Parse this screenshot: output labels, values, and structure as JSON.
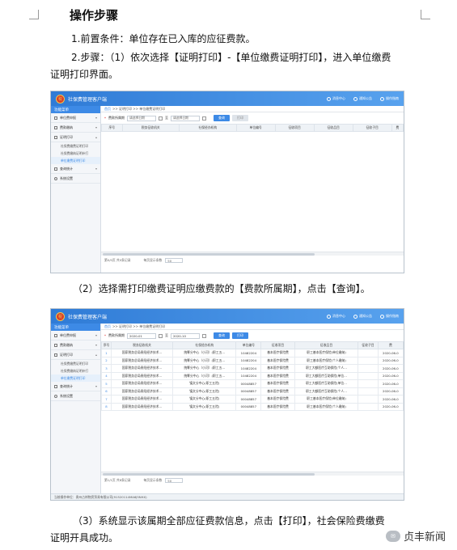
{
  "document": {
    "title": "操作步骤",
    "step1": "1.前置条件：单位存在已入库的应征费款。",
    "step2_line1": "2.步骤：（1）依次选择【证明打印】-【单位缴费证明打印】，进入单位缴费",
    "step2_line2": "证明打印界面。",
    "step2b": "（2）选择需打印缴费证明应缴费款的【费款所属期】，点击【查询】。",
    "step3_line1": "（3）系统显示该属期全部应征费款信息，点击【打印】，社会保险费缴费",
    "step3_line2": "证明开具成功。"
  },
  "app": {
    "title": "社保费管理客户端",
    "emblem": "税",
    "top_links": [
      "消息中心",
      "通知公告",
      "操作指南"
    ],
    "home": "功能菜单",
    "menu": [
      {
        "label": "单位费申报"
      },
      {
        "label": "费款缴纳"
      },
      {
        "label": "证明打印"
      }
    ],
    "submenu": [
      "社保费缴费证明打印",
      "社保费缴纳证明补打",
      "单位缴费证明打印"
    ],
    "menu_after": [
      {
        "label": "查询统计"
      },
      {
        "label": "系统设置"
      }
    ],
    "breadcrumb_home": "首页",
    "breadcrumb_path": ">> 证明打印 >> 单位缴费证明打印",
    "breadcrumb_tab": "单位缴费证明打印",
    "period_label": "费款所属期",
    "to_label": "至",
    "start_placeholder": "请选择日期",
    "end_placeholder": "请选择日期",
    "start_value": "2020-01",
    "end_value": "2020-10",
    "query_button": "查询",
    "print_button": "打印",
    "columns": [
      "序号",
      "税务征收机关",
      "社保经办机构",
      "单位编号",
      "征收项目",
      "征收品目",
      "征收子目",
      "费"
    ],
    "rows": [
      [
        "1",
        "国家税务总局贵阳经济技术…",
        "统筹分中心（小河）(职工五…",
        "10482204",
        "基本医疗保险费",
        "职工基本医疗保险(单位缴纳)",
        "",
        "2020-06-0"
      ],
      [
        "2",
        "国家税务总局贵阳经济技术…",
        "统筹分中心（小河）(职工五…",
        "10482204",
        "基本医疗保险费",
        "职工基本医疗保险(个人缴纳)",
        "",
        "2020-06-0"
      ],
      [
        "3",
        "国家税务总局贵阳经济技术…",
        "统筹分中心（小河）(职工五…",
        "10482204",
        "基本医疗保险费",
        "职工大额医疗互助保险(个人…",
        "",
        "2020-06-0"
      ],
      [
        "4",
        "国家税务总局贵阳经济技术…",
        "统筹分中心（小河）(职工五…",
        "10482204",
        "基本医疗保险费",
        "职工大额医疗互助保险(单位…",
        "",
        "2020-06-0"
      ],
      [
        "5",
        "国家税务总局贵阳经济技术…",
        "镇文分中心(职工五险)",
        "00048857",
        "基本医疗保险费",
        "职工大额医疗互助保险(单位…",
        "",
        "2020-06-0"
      ],
      [
        "6",
        "国家税务总局贵阳经济技术…",
        "镇文分中心(职工五险)",
        "00048857",
        "基本医疗保险费",
        "职工大额医疗互助保险(个人…",
        "",
        "2020-06-0"
      ],
      [
        "7",
        "国家税务总局贵阳经济技术…",
        "镇文分中心(职工五险)",
        "00048857",
        "基本医疗保险费",
        "职工基本医疗保险(单位缴纳)",
        "",
        "2020-06-0"
      ],
      [
        "8",
        "国家税务总局贵阳经济技术…",
        "镇文分中心(职工五险)",
        "00048857",
        "基本医疗保险费",
        "职工基本医疗保险(个人缴纳)",
        "",
        "2020-06-0"
      ]
    ],
    "pager_text": "第0/0页 共0条记录",
    "pager_text2": "第1/1页 共8条记录",
    "page_size_label": "每页显示条数",
    "page_size": "50",
    "status": "当前操作单位：贵州占祥物资贸易有限公司(91520114MA6J5NHX)"
  },
  "watermark": {
    "icon_text": "公众号",
    "text": "贞丰新闻"
  },
  "colors": {
    "header_blue": "#3d8ae6",
    "border": "#b8c2cc"
  }
}
